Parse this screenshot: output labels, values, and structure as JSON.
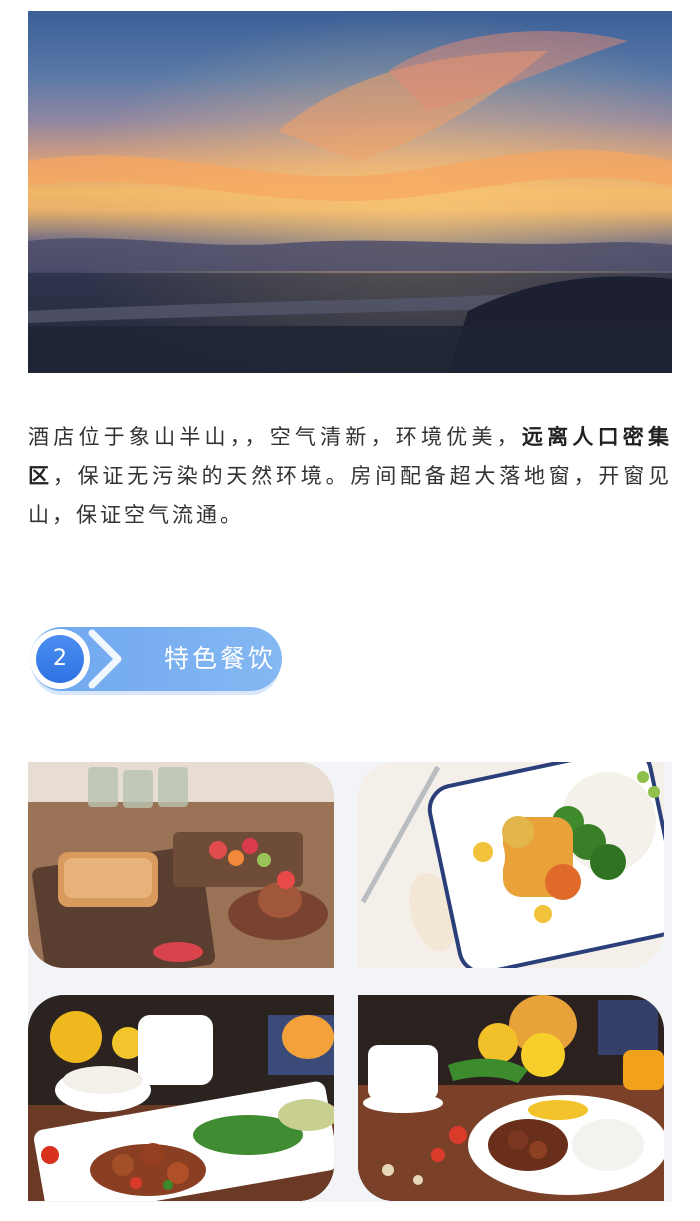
{
  "hero": {
    "icon": "sunset-cityscape-photo"
  },
  "intro": {
    "part1": "酒店位于象山半山，，空气清新，环境优美，",
    "bold": "远离人口密集区",
    "part2": "，保证无污染的天然环境。房间配备超大落地窗，开窗见山，保证空气流通。"
  },
  "section": {
    "number": "2",
    "title": "特色餐饮"
  },
  "gallery": [
    {
      "icon": "breakfast-toast-fruit-photo"
    },
    {
      "icon": "bento-box-curry-photo"
    },
    {
      "icon": "chinese-dishes-set-photo"
    },
    {
      "icon": "braised-meat-rice-photo"
    }
  ],
  "colors": {
    "accent": "#6fa7ef",
    "badge_circle": "#3a7de8"
  }
}
